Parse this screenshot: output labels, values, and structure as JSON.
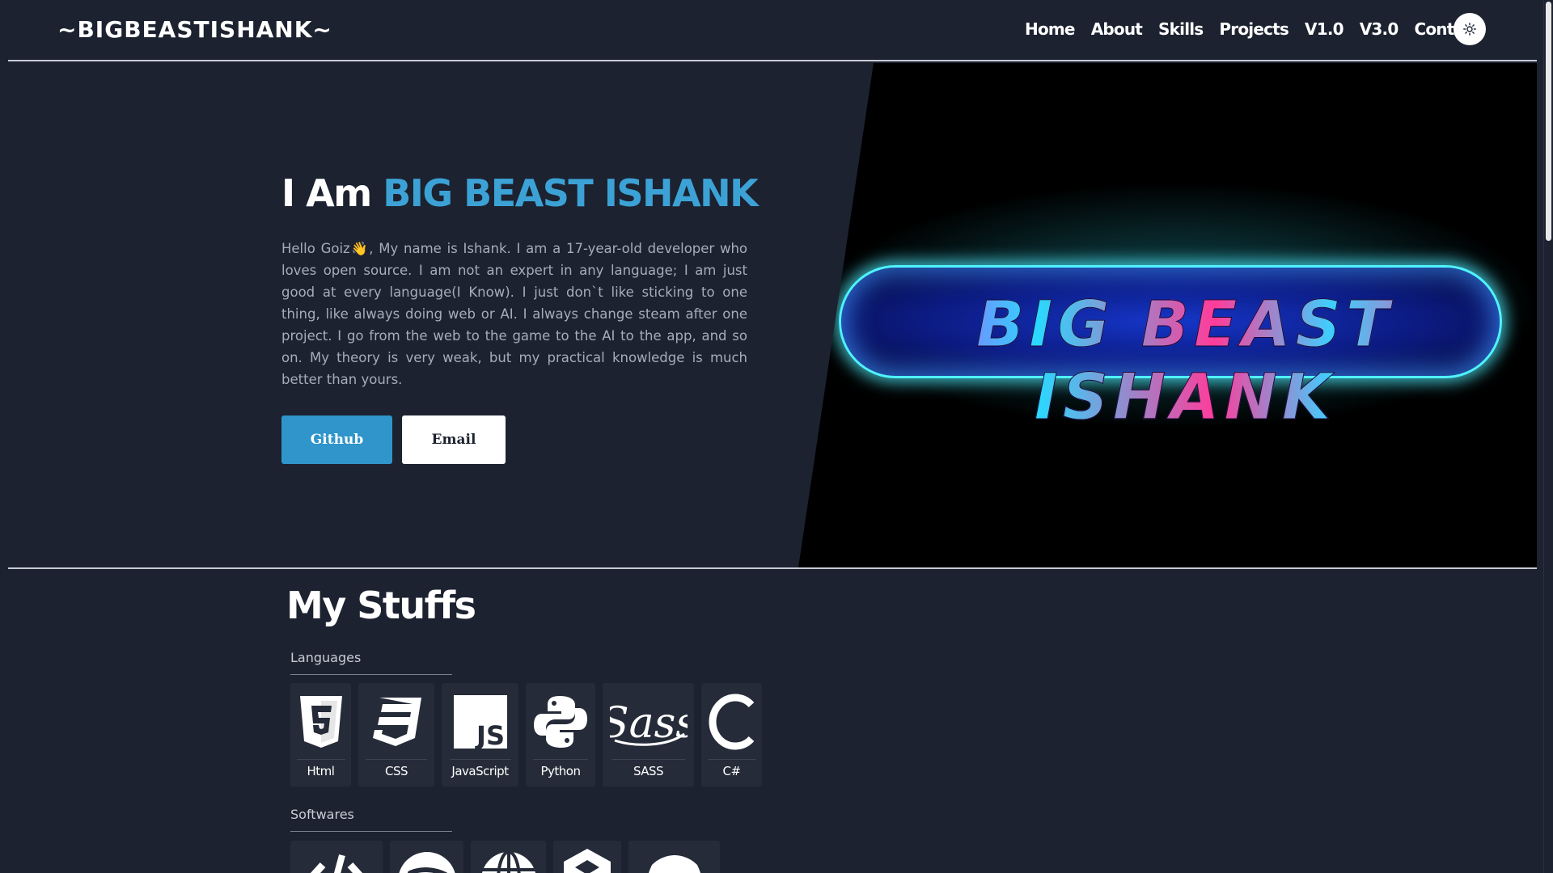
{
  "navbar": {
    "brand": "~BIGBEASTISHANK~",
    "links": [
      "Home",
      "About",
      "Skills",
      "Projects",
      "V1.0",
      "V3.0",
      "Contact"
    ]
  },
  "hero": {
    "title_prefix": "I Am ",
    "title_name": "BIG BEAST ISHANK",
    "description": "Hello Goiz👋, My name is Ishank. I am a 17-year-old developer who loves open source. I am not an expert in any language; I am just good at every language(I Know). I just don`t like sticking to one thing, like always doing web or AI. I always change steam after one project. I go from the web to the game to the AI to the app, and so on. My theory is very weak, but my practical knowledge is much better than yours.",
    "github_label": "Github",
    "email_label": "Email",
    "banner_text": "BIG BEAST ISHANK"
  },
  "stuffs": {
    "title": "My Stuffs",
    "languages_label": "Languages",
    "languages": [
      {
        "label": "Html",
        "icon": "html5-icon"
      },
      {
        "label": "CSS",
        "icon": "css3-icon"
      },
      {
        "label": "JavaScript",
        "icon": "javascript-icon"
      },
      {
        "label": "Python",
        "icon": "python-icon"
      },
      {
        "label": "SASS",
        "icon": "sass-icon"
      },
      {
        "label": "C#",
        "icon": "csharp-icon"
      }
    ],
    "softwares_label": "Softwares",
    "softwares": [
      {
        "icon": "code-icon"
      },
      {
        "icon": "spotify-icon"
      },
      {
        "icon": "globe-icon"
      },
      {
        "icon": "unity-icon"
      },
      {
        "icon": "discord-icon"
      }
    ]
  },
  "colors": {
    "background": "#1c2230",
    "accent": "#3ca2d6",
    "github_button": "#2f95cb",
    "tile": "#252b38"
  }
}
